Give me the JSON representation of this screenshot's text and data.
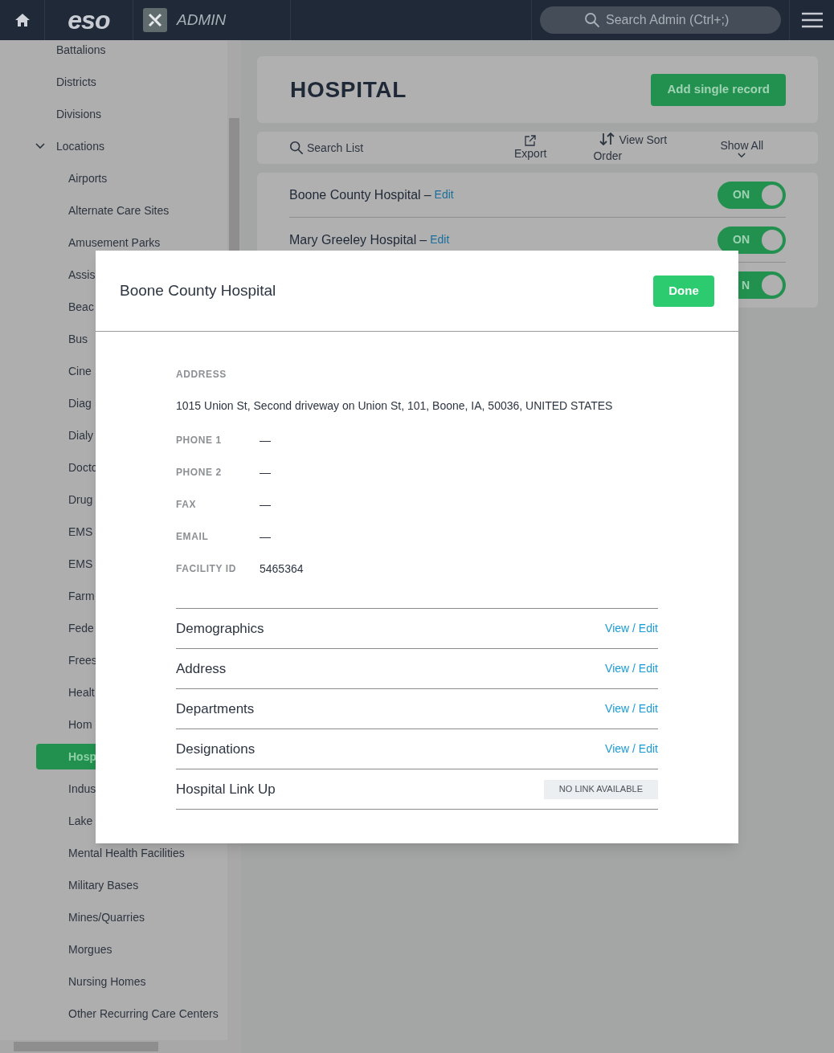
{
  "header": {
    "logo": "eso",
    "app": "ADMIN",
    "search": {
      "placeholder": "Search Admin (Ctrl+;)"
    }
  },
  "sidebar": {
    "items": [
      {
        "label": "Battalions",
        "selected": false
      },
      {
        "label": "Districts",
        "selected": false
      },
      {
        "label": "Divisions",
        "selected": false
      },
      {
        "label": "Locations",
        "selected": false,
        "expanded": true,
        "children": [
          {
            "label": "Airports",
            "selected": false
          },
          {
            "label": "Alternate Care Sites",
            "selected": false
          },
          {
            "label": "Amusement Parks",
            "selected": false
          },
          {
            "label": "Assis",
            "selected": false
          },
          {
            "label": "Beac",
            "selected": false
          },
          {
            "label": "Bus",
            "selected": false
          },
          {
            "label": "Cine",
            "selected": false
          },
          {
            "label": "Diag",
            "selected": false
          },
          {
            "label": "Dialy",
            "selected": false
          },
          {
            "label": "Docto",
            "selected": false
          },
          {
            "label": "Drug",
            "selected": false
          },
          {
            "label": "EMS",
            "selected": false
          },
          {
            "label": "EMS",
            "selected": false
          },
          {
            "label": "Farm",
            "selected": false
          },
          {
            "label": "Fede",
            "selected": false
          },
          {
            "label": "Frees",
            "selected": false
          },
          {
            "label": "Healt",
            "selected": false
          },
          {
            "label": "Hom",
            "selected": false
          },
          {
            "label": "Hosp",
            "selected": true
          },
          {
            "label": "Indus",
            "selected": false
          },
          {
            "label": "Lake",
            "selected": false
          },
          {
            "label": "Mental Health Facilities",
            "selected": false
          },
          {
            "label": "Military Bases",
            "selected": false
          },
          {
            "label": "Mines/Quarries",
            "selected": false
          },
          {
            "label": "Morgues",
            "selected": false
          },
          {
            "label": "Nursing Homes",
            "selected": false
          },
          {
            "label": "Other Recurring Care Centers",
            "selected": false
          }
        ]
      }
    ]
  },
  "page": {
    "title": "HOSPITAL",
    "add_button": "Add single record",
    "toolbar": {
      "search": "Search List",
      "export": "Export",
      "sort": "View Sort Order",
      "filter": "Show All"
    },
    "rows": [
      {
        "name": "Boone County Hospital",
        "separator": "–",
        "edit": "Edit",
        "toggle": "ON",
        "on": true
      },
      {
        "name": "Mary Greeley Hospital",
        "separator": "–",
        "edit": "Edit",
        "toggle": "ON",
        "on": true
      },
      {
        "toggle": "N",
        "on": true
      }
    ]
  },
  "modal": {
    "title": "Boone County Hospital",
    "done": "Done",
    "address_label": "ADDRESS",
    "address": "1015 Union St, Second driveway on Union St, 101, Boone, IA, 50036, UNITED STATES",
    "fields": [
      {
        "label": "PHONE 1",
        "value": "—"
      },
      {
        "label": "PHONE 2",
        "value": "—"
      },
      {
        "label": "FAX",
        "value": "—"
      },
      {
        "label": "EMAIL",
        "value": "—"
      },
      {
        "label": "FACILITY ID",
        "value": "5465364"
      }
    ],
    "sections": [
      {
        "title": "Demographics",
        "kind": "link",
        "action": "View / Edit"
      },
      {
        "title": "Address",
        "kind": "link",
        "action": "View / Edit"
      },
      {
        "title": "Departments",
        "kind": "link",
        "action": "View / Edit"
      },
      {
        "title": "Designations",
        "kind": "link",
        "action": "View / Edit"
      },
      {
        "title": "Hospital Link Up",
        "kind": "status",
        "action": "NO LINK AVAILABLE"
      }
    ]
  }
}
